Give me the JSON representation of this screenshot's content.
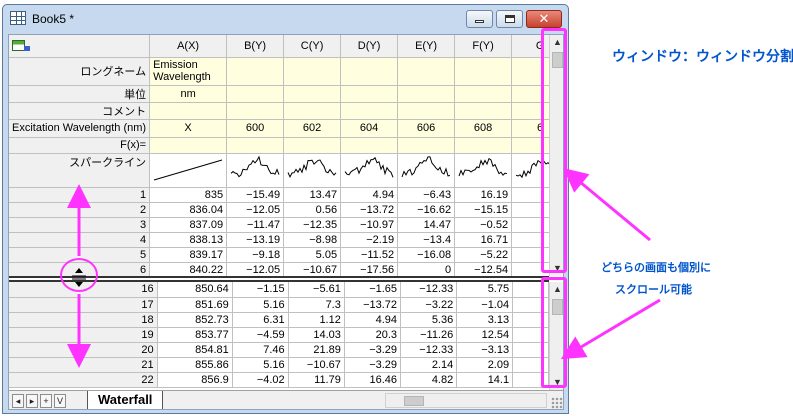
{
  "window": {
    "title": "Book5 *"
  },
  "columns": [
    "A(X)",
    "B(Y)",
    "C(Y)",
    "D(Y)",
    "E(Y)",
    "F(Y)",
    "G"
  ],
  "meta_rows": [
    {
      "label": "ロングネーム",
      "values": [
        "Emission Wavelength",
        "",
        "",
        "",
        "",
        "",
        ""
      ]
    },
    {
      "label": "単位",
      "values": [
        "nm",
        "",
        "",
        "",
        "",
        "",
        ""
      ]
    },
    {
      "label": "コメント",
      "values": [
        "",
        "",
        "",
        "",
        "",
        "",
        ""
      ]
    },
    {
      "label": "Excitation Wavelength (nm)",
      "values": [
        "X",
        "600",
        "602",
        "604",
        "606",
        "608",
        "6"
      ]
    },
    {
      "label": "F(x)=",
      "values": [
        "",
        "",
        "",
        "",
        "",
        "",
        ""
      ]
    }
  ],
  "sparkline_label": "スパークライン",
  "top_rows": [
    {
      "n": "1",
      "cells": [
        "835",
        "−15.49",
        "13.47",
        "4.94",
        "−6.43",
        "16.19",
        ""
      ]
    },
    {
      "n": "2",
      "cells": [
        "836.04",
        "−12.05",
        "0.56",
        "−13.72",
        "−16.62",
        "−15.15",
        ""
      ]
    },
    {
      "n": "3",
      "cells": [
        "837.09",
        "−11.47",
        "−12.35",
        "−10.97",
        "14.47",
        "−0.52",
        ""
      ]
    },
    {
      "n": "4",
      "cells": [
        "838.13",
        "−13.19",
        "−8.98",
        "−2.19",
        "−13.4",
        "16.71",
        ""
      ]
    },
    {
      "n": "5",
      "cells": [
        "839.17",
        "−9.18",
        "5.05",
        "−11.52",
        "−16.08",
        "−5.22",
        "−"
      ]
    },
    {
      "n": "6",
      "cells": [
        "840.22",
        "−12.05",
        "−10.67",
        "−17.56",
        "0",
        "−12.54",
        ""
      ]
    }
  ],
  "bottom_rows": [
    {
      "n": "16",
      "cells": [
        "850.64",
        "−1.15",
        "−5.61",
        "−1.65",
        "−12.33",
        "5.75",
        ""
      ]
    },
    {
      "n": "17",
      "cells": [
        "851.69",
        "5.16",
        "7.3",
        "−13.72",
        "−3.22",
        "−1.04",
        ""
      ]
    },
    {
      "n": "18",
      "cells": [
        "852.73",
        "6.31",
        "1.12",
        "4.94",
        "5.36",
        "3.13",
        ""
      ]
    },
    {
      "n": "19",
      "cells": [
        "853.77",
        "−4.59",
        "14.03",
        "20.3",
        "−11.26",
        "12.54",
        ""
      ]
    },
    {
      "n": "20",
      "cells": [
        "854.81",
        "7.46",
        "21.89",
        "−3.29",
        "−12.33",
        "−3.13",
        ""
      ]
    },
    {
      "n": "21",
      "cells": [
        "855.86",
        "5.16",
        "−10.67",
        "−3.29",
        "2.14",
        "2.09",
        ""
      ]
    },
    {
      "n": "22",
      "cells": [
        "856.9",
        "−4.02",
        "11.79",
        "16.46",
        "4.82",
        "14.1",
        ""
      ]
    }
  ],
  "sheet_tab": "Waterfall",
  "nav_buttons": [
    "◂",
    "▸",
    "+",
    "V"
  ],
  "annotations": {
    "menu_path": "ウィンドウ：ウィンドウ分割",
    "note_line1": "どちらの画面も個別に",
    "note_line2": "スクロール可能"
  },
  "colors": {
    "annotation_magenta": "#ff33ff",
    "annotation_text_blue": "#0055cc",
    "meta_row_yellow": "#ffffe0"
  }
}
